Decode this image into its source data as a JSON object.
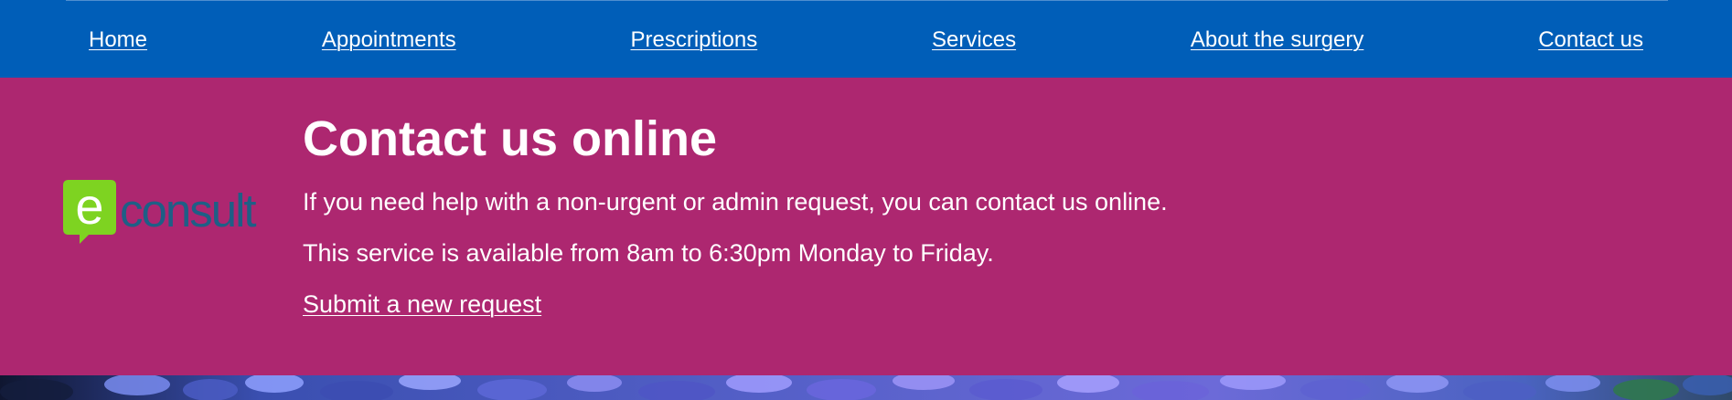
{
  "nav": {
    "items": [
      {
        "label": "Home"
      },
      {
        "label": "Appointments"
      },
      {
        "label": "Prescriptions"
      },
      {
        "label": "Services"
      },
      {
        "label": "About the surgery"
      },
      {
        "label": "Contact us"
      }
    ]
  },
  "contact": {
    "logo_text": "consult",
    "logo_letter": "e",
    "title": "Contact us online",
    "paragraph_1": "If you need help with a non-urgent or admin request, you can contact us online.",
    "paragraph_2": "This service is available from 8am to 6:30pm Monday to Friday.",
    "submit_link": "Submit a new request"
  },
  "colors": {
    "nav_background": "#005eb8",
    "banner_background": "#ad2770",
    "logo_green": "#7ed321",
    "logo_blue": "#1e5f86",
    "text": "#ffffff"
  },
  "hero_image": {
    "icon": "hydrangea-flowers-photo"
  }
}
